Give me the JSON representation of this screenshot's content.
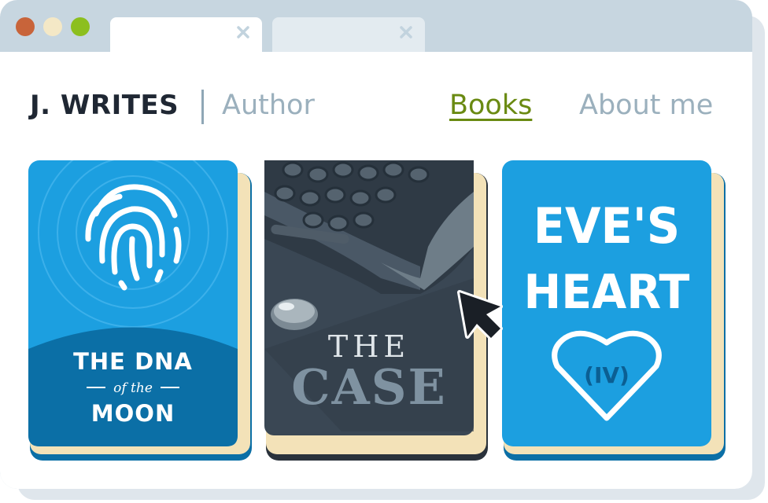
{
  "window": {
    "controls": [
      "close",
      "minimize",
      "maximize"
    ],
    "colors": {
      "close": "#c8643a",
      "minimize": "#f4e8c6",
      "maximize": "#8cbf1e"
    }
  },
  "tabs": [
    {
      "active": true
    },
    {
      "active": false
    }
  ],
  "header": {
    "brand": "J. WRITES",
    "tagline": "Author",
    "nav": [
      {
        "label": "Books",
        "active": true
      },
      {
        "label": "About me",
        "active": false
      }
    ]
  },
  "books": [
    {
      "line1": "THE DNA",
      "line2": "of the",
      "line3": "MOON",
      "icon": "fingerprint-icon",
      "cover_color": "#1c9fe0"
    },
    {
      "line1": "THE",
      "line2": "CASE",
      "icon": "typewriter-illustration",
      "cover_color": "#3a4754"
    },
    {
      "line1": "EVE'S",
      "line2": "HEART",
      "line3": "(IV)",
      "icon": "heart-icon",
      "cover_color": "#1c9fe0"
    }
  ],
  "cursor": {
    "icon": "pointer-cursor-icon"
  },
  "colors": {
    "accent": "#6a8a12",
    "muted": "#9bb0bd",
    "text": "#1f2733"
  }
}
